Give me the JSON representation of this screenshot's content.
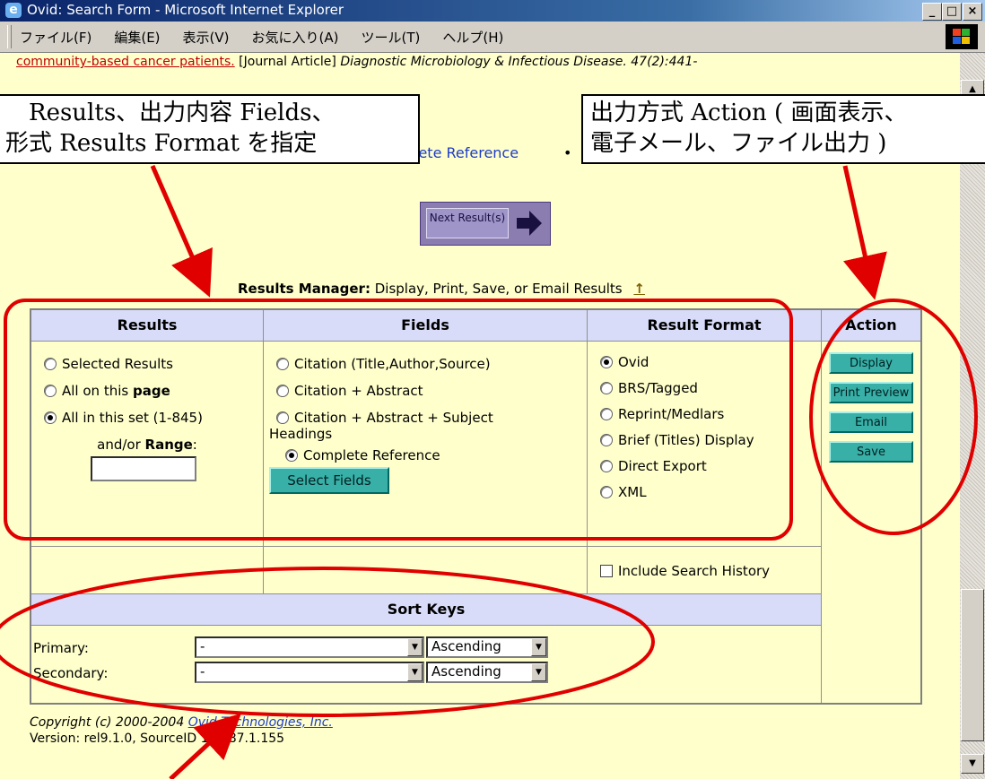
{
  "window": {
    "title": "Ovid: Search Form - Microsoft Internet Explorer",
    "minimize": "_",
    "maximize": "□",
    "close": "×"
  },
  "menu": [
    "ファイル(F)",
    "編集(E)",
    "表示(V)",
    "お気に入り(A)",
    "ツール(T)",
    "ヘルプ(H)"
  ],
  "page": {
    "cut_line": {
      "link": "community-based cancer patients.",
      "type": "[Journal Article]",
      "source": "Diagnostic Microbiology & Infectious Disease. 47(2):441-"
    },
    "complete_reference_partial": "lete Reference",
    "bullet": "•",
    "next_button": "Next Result(s)",
    "results_manager": {
      "label": "Results Manager:",
      "text": "Display, Print, Save, or Email Results",
      "up_icon": "↑"
    },
    "columns": {
      "results": "Results",
      "fields": "Fields",
      "format": "Result Format",
      "action": "Action"
    },
    "results_options": {
      "selected": "Selected Results",
      "all_on_page_pre": "All on this ",
      "all_on_page_bold": "page",
      "all_in_set": "All in this set (1-845)",
      "range_pre": "and/or ",
      "range_bold": "Range",
      "range_colon": ":",
      "range_value": ""
    },
    "fields_options": {
      "citation": "Citation (Title,Author,Source)",
      "citation_abstract": "Citation + Abstract",
      "citation_abstract_subject": "Citation + Abstract + Subject",
      "headings": "Headings",
      "complete": "Complete Reference",
      "select_fields": "Select Fields"
    },
    "format_options": {
      "ovid": "Ovid",
      "brs": "BRS/Tagged",
      "reprint": "Reprint/Medlars",
      "brief": "Brief (Titles) Display",
      "direct": "Direct Export",
      "xml": "XML",
      "include_history": "Include Search History"
    },
    "actions": {
      "display": "Display",
      "print_preview": "Print Preview",
      "email": "Email",
      "save": "Save"
    },
    "sort": {
      "title": "Sort Keys",
      "primary_label": "Primary:",
      "secondary_label": "Secondary:",
      "primary_value": "-",
      "secondary_value": "-",
      "primary_order": "Ascending",
      "secondary_order": "Ascending"
    },
    "footer": {
      "copyright_pre": "Copyright (c) 2000-2004 ",
      "company": "Ovid Technologies, Inc.",
      "version": "Version: rel9.1.0, SourceID 1.9087.1.155"
    }
  },
  "annotations": {
    "left_line1": "Results、出力内容 Fields、",
    "left_line2": "形式 Results Format を指定",
    "right_line1": "出力方式 Action ( 画面表示、",
    "right_line2": "電子メール、ファイル出力 )"
  },
  "colors": {
    "page_bg": "#ffffcc",
    "header_bg": "#d8dcf8",
    "action_button": "#38b0a8",
    "annotation_red": "#e00000"
  }
}
